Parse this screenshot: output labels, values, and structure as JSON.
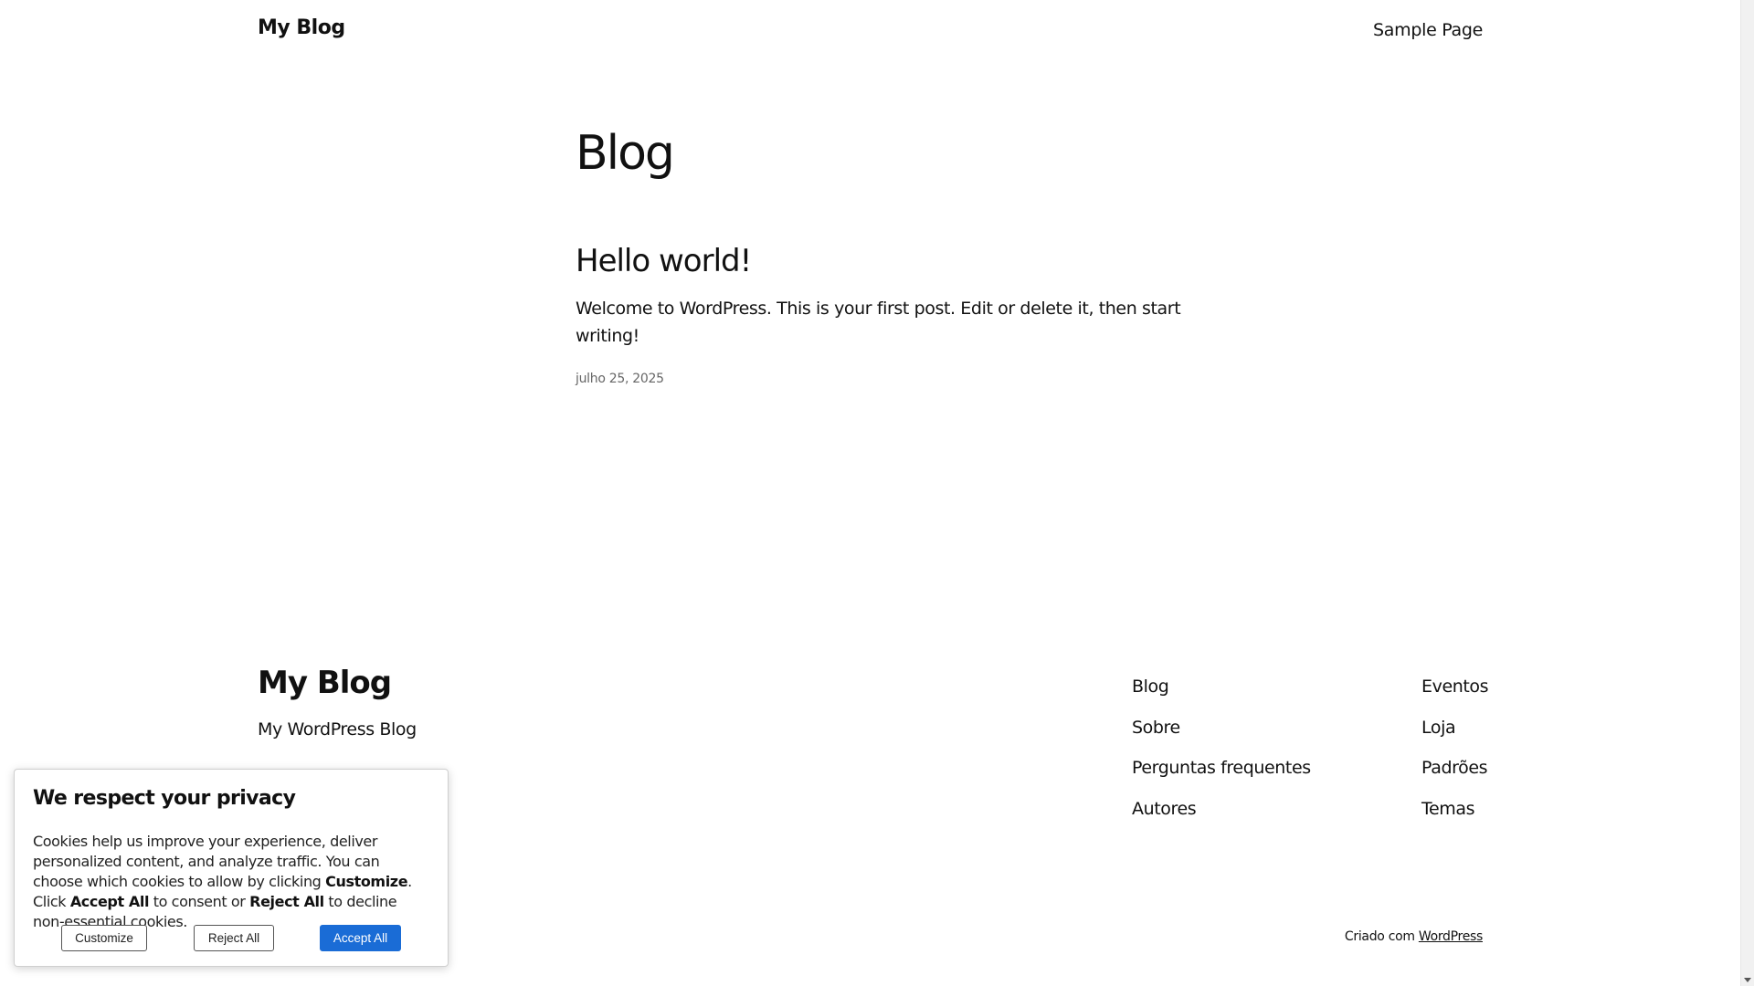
{
  "header": {
    "site_title": "My Blog",
    "nav": [
      "Sample Page"
    ]
  },
  "main": {
    "page_heading": "Blog",
    "post": {
      "title": "Hello world!",
      "excerpt": "Welcome to WordPress. This is your first post. Edit or delete it, then start writing!",
      "date": "julho 25, 2025"
    }
  },
  "footer": {
    "site_title": "My Blog",
    "tagline": "My WordPress Blog",
    "columns": [
      [
        "Blog",
        "Sobre",
        "Perguntas frequentes",
        "Autores"
      ],
      [
        "Eventos",
        "Loja",
        "Padrões",
        "Temas"
      ]
    ],
    "credit_prefix": "Criado com",
    "credit_link": "WordPress"
  },
  "cookie_banner": {
    "title": "We respect your privacy",
    "text_1": "Cookies help us improve your experience, deliver personalized content, and analyze traffic. You can choose which cookies to allow by clicking ",
    "bold_customize": "Customize",
    "text_2": ". Click ",
    "bold_accept": "Accept All",
    "text_3": " to consent or ",
    "bold_reject": "Reject All",
    "text_4": " to decline non-essential cookies.",
    "buttons": {
      "customize": "Customize",
      "reject": "Reject All",
      "accept": "Accept All"
    },
    "accept_color": "#1a6cd6"
  }
}
